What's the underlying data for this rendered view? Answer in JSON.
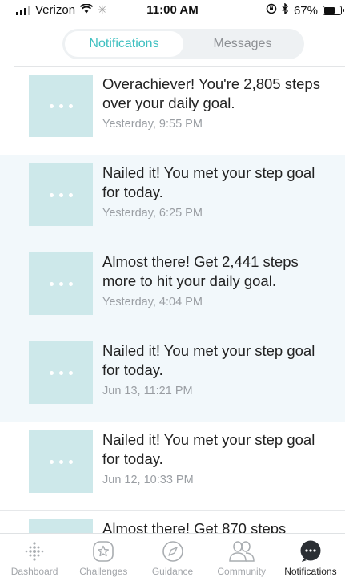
{
  "status_bar": {
    "carrier": "Verizon",
    "time": "11:00 AM",
    "battery_percent": "67%",
    "battery_level": 0.67
  },
  "tabs": [
    {
      "label": "Notifications",
      "active": true
    },
    {
      "label": "Messages",
      "active": false
    }
  ],
  "notifications": [
    {
      "message": "Overachiever! You're 2,805 steps over your daily goal.",
      "time": "Yesterday, 9:55 PM",
      "highlighted": false
    },
    {
      "message": "Nailed it! You met your step goal for today.",
      "time": "Yesterday, 6:25 PM",
      "highlighted": true
    },
    {
      "message": "Almost there! Get 2,441 steps more to hit your daily goal.",
      "time": "Yesterday, 4:04 PM",
      "highlighted": true
    },
    {
      "message": "Nailed it! You met your step goal for today.",
      "time": "Jun 13, 11:21 PM",
      "highlighted": true
    },
    {
      "message": "Nailed it! You met your step goal for today.",
      "time": "Jun 12, 10:33 PM",
      "highlighted": false
    },
    {
      "message": "Almost there! Get 870 steps",
      "time": "",
      "highlighted": false
    }
  ],
  "bottom_nav": [
    {
      "label": "Dashboard",
      "icon": "dashboard-dots-icon",
      "active": false
    },
    {
      "label": "Challenges",
      "icon": "star-badge-icon",
      "active": false
    },
    {
      "label": "Guidance",
      "icon": "compass-icon",
      "active": false
    },
    {
      "label": "Community",
      "icon": "people-icon",
      "active": false
    },
    {
      "label": "Notifications",
      "icon": "chat-bubble-icon",
      "active": true
    }
  ],
  "colors": {
    "accent": "#3dbfc0",
    "thumb": "#cde8ea",
    "highlight_row": "#f2f8fb",
    "active_nav_icon": "#2a2e33"
  }
}
